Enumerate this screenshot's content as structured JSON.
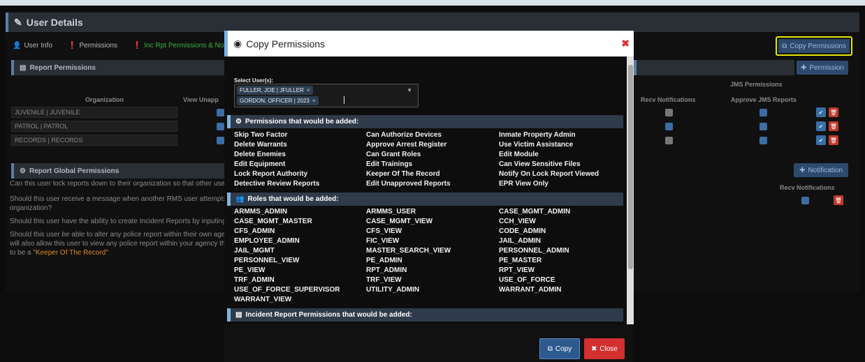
{
  "page": {
    "title": "User Details",
    "tabs": [
      {
        "label": "User Info",
        "icon": "user-icon"
      },
      {
        "label": "Permissions",
        "icon": "info-icon"
      },
      {
        "label": "Inc Rpt Permissions & Notifica",
        "icon": "info-icon"
      }
    ],
    "copy_permissions_label": "Copy Permissions"
  },
  "background": {
    "report_permissions_title": "Report Permissions",
    "permission_button": "Permission",
    "organization_header": "Organization",
    "view_unapproved_header": "View Unapp",
    "recv_notifications_header": "Recv Notifications",
    "jms_permissions_header": "JMS Permissions",
    "approve_jms_header": "Approve JMS Reports",
    "rows": [
      "JUVENILE | JUVENILE",
      "PATROL | PATROL",
      "RECORDS | RECORDS"
    ],
    "global_title": "Report Global Permissions",
    "notification_button": "Notification",
    "recv_notifications_label": "Recv Notifications",
    "q1": "Can this user lock reports down to their organization so that other users",
    "q2a": "Should this user receive a message when another RMS user attempts to l",
    "q2b": "organization?",
    "q3": "Should this user have the ability to create Incident Reports by inputing a",
    "q4a": "Should this user be able to alter any police report within their own agenc",
    "q4b": "will also allow this user to view any police report within your agency that",
    "q4c_prefix": "to be a ",
    "q4c_highlight": "\"Keeper Of The Record\""
  },
  "modal": {
    "title": "Copy Permissions",
    "select_label": "Select User(s):",
    "selected_users": [
      "FULLER, JOE | JFULLER",
      "GORDON, OFFICER | 2023"
    ],
    "perm_section": "Permissions that would be added:",
    "permissions": [
      "Skip Two Factor",
      "Can Authorize Devices",
      "Inmate Property Admin",
      "Delete Warrants",
      "Approve Arrest Register",
      "Use Victim Assistance",
      "Delete Enemies",
      "Can Grant Roles",
      "Edit Module",
      "Edit Equipment",
      "Edit Trainings",
      "Can View Sensitive Files",
      "Lock Report Authority",
      "Keeper Of The Record",
      "Notify On Lock Report Viewed",
      "Detective Review Reports",
      "Edit Unapproved Reports",
      "EPR View Only"
    ],
    "roles_section": "Roles that would be added:",
    "roles": [
      "ARMMS_ADMIN",
      "ARMMS_USER",
      "CASE_MGMT_ADMIN",
      "CASE_MGMT_MASTER",
      "CASE_MGMT_VIEW",
      "CCH_VIEW",
      "CFS_ADMIN",
      "CFS_VIEW",
      "CODE_ADMIN",
      "EMPLOYEE_ADMIN",
      "FIC_VIEW",
      "JAIL_ADMIN",
      "JAIL_MGMT",
      "MASTER_SEARCH_VIEW",
      "PERSONNEL_ADMIN",
      "PERSONNEL_VIEW",
      "PE_ADMIN",
      "PE_MASTER",
      "PE_VIEW",
      "RPT_ADMIN",
      "RPT_VIEW",
      "TRF_ADMIN",
      "TRF_VIEW",
      "USE_OF_FORCE",
      "USE_OF_FORCE_SUPERVISOR",
      "UTILITY_ADMIN",
      "WARRANT_ADMIN",
      "WARRANT_VIEW"
    ],
    "incident_section": "Incident Report Permissions that would be added:",
    "copy_button": "Copy",
    "close_button": "Close"
  },
  "colors": {
    "accent_blue": "#2d5a8e",
    "close_red": "#d32f2f",
    "highlight_yellow": "#e6e600",
    "tab_green": "#3cb043"
  }
}
